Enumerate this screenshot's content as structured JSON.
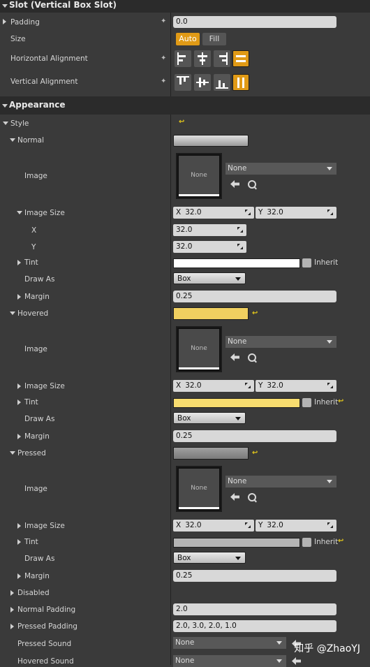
{
  "slot_section": {
    "title": "Slot (Vertical Box Slot)",
    "padding_label": "Padding",
    "padding_value": "0.0",
    "size_label": "Size",
    "size_auto": "Auto",
    "size_fill": "Fill",
    "halign_label": "Horizontal Alignment",
    "valign_label": "Vertical Alignment"
  },
  "appearance_section": {
    "title": "Appearance",
    "style_label": "Style"
  },
  "normal": {
    "label": "Normal",
    "image_label": "Image",
    "image_thumb": "None",
    "image_combo": "None",
    "image_size_label": "Image Size",
    "x_label": "X",
    "y_label": "Y",
    "size_x": "32.0",
    "size_y": "32.0",
    "x_field": "32.0",
    "y_field": "32.0",
    "tint_label": "Tint",
    "inherit_label": "Inherit",
    "draw_as_label": "Draw As",
    "draw_as_value": "Box",
    "margin_label": "Margin",
    "margin_value": "0.25"
  },
  "hovered": {
    "label": "Hovered",
    "image_label": "Image",
    "image_thumb": "None",
    "image_combo": "None",
    "image_size_label": "Image Size",
    "size_x": "32.0",
    "size_y": "32.0",
    "tint_label": "Tint",
    "inherit_label": "Inherit",
    "draw_as_label": "Draw As",
    "draw_as_value": "Box",
    "margin_label": "Margin",
    "margin_value": "0.25"
  },
  "pressed": {
    "label": "Pressed",
    "image_label": "Image",
    "image_thumb": "None",
    "image_combo": "None",
    "image_size_label": "Image Size",
    "size_x": "32.0",
    "size_y": "32.0",
    "tint_label": "Tint",
    "inherit_label": "Inherit",
    "draw_as_label": "Draw As",
    "draw_as_value": "Box",
    "margin_label": "Margin",
    "margin_value": "0.25"
  },
  "other": {
    "disabled_label": "Disabled",
    "normal_padding_label": "Normal Padding",
    "normal_padding_value": "2.0",
    "pressed_padding_label": "Pressed Padding",
    "pressed_padding_value": "2.0, 3.0, 2.0, 1.0",
    "pressed_sound_label": "Pressed Sound",
    "pressed_sound_value": "None",
    "hovered_sound_label": "Hovered Sound",
    "hovered_sound_value": "None"
  },
  "watermark": "知乎 @ZhaoYJ",
  "colors": {
    "accent": "#e09a16",
    "hovered_tint": "#f7dc6f",
    "reset_arrow": "#e2c61a"
  }
}
